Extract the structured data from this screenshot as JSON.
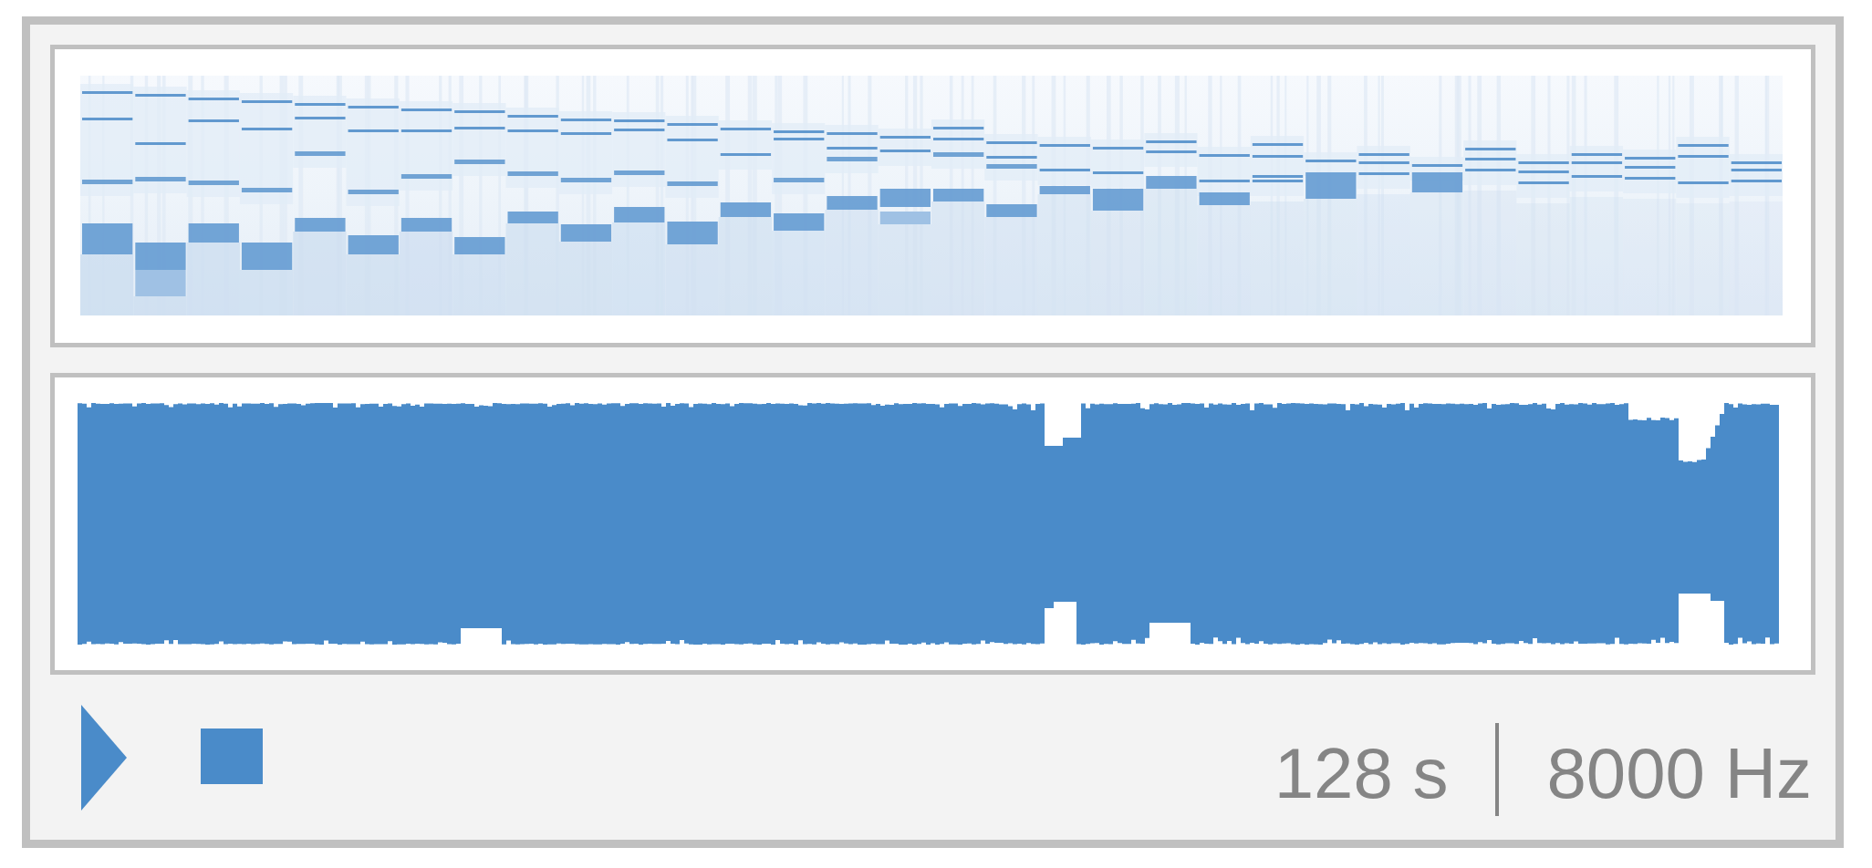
{
  "player": {
    "duration": "128 s",
    "sample_rate": "8000 Hz"
  }
}
